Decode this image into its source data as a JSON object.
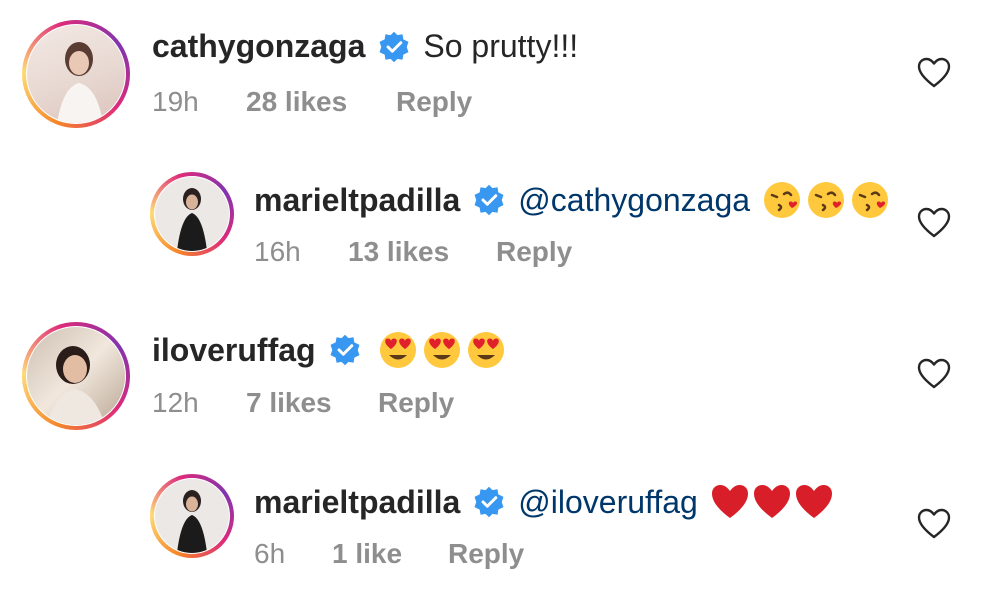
{
  "comments": [
    {
      "username": "cathygonzaga",
      "text": "So prutty!!!",
      "time": "19h",
      "likes": "28 likes",
      "reply": "Reply",
      "emojis": []
    },
    {
      "username": "marieltpadilla",
      "text": "@cathygonzaga",
      "time": "16h",
      "likes": "13 likes",
      "reply": "Reply",
      "emojis": [
        "kissing-heart-emoji",
        "kissing-heart-emoji",
        "kissing-heart-emoji"
      ]
    },
    {
      "username": "iloveruffag",
      "text": "",
      "time": "12h",
      "likes": "7 likes",
      "reply": "Reply",
      "emojis": [
        "heart-eyes-emoji",
        "heart-eyes-emoji",
        "heart-eyes-emoji"
      ]
    },
    {
      "username": "marieltpadilla",
      "text": "@iloveruffag",
      "time": "6h",
      "likes": "1 like",
      "reply": "Reply",
      "emojis": [
        "red-heart-emoji",
        "red-heart-emoji",
        "red-heart-emoji"
      ]
    }
  ],
  "icons": {
    "verified": "verified-badge-icon",
    "like": "heart-outline-icon"
  },
  "colors": {
    "verified_blue": "#3897f0",
    "mention": "#00376b",
    "meta_gray": "#8e8e8e",
    "heart_red": "#e0202a"
  }
}
